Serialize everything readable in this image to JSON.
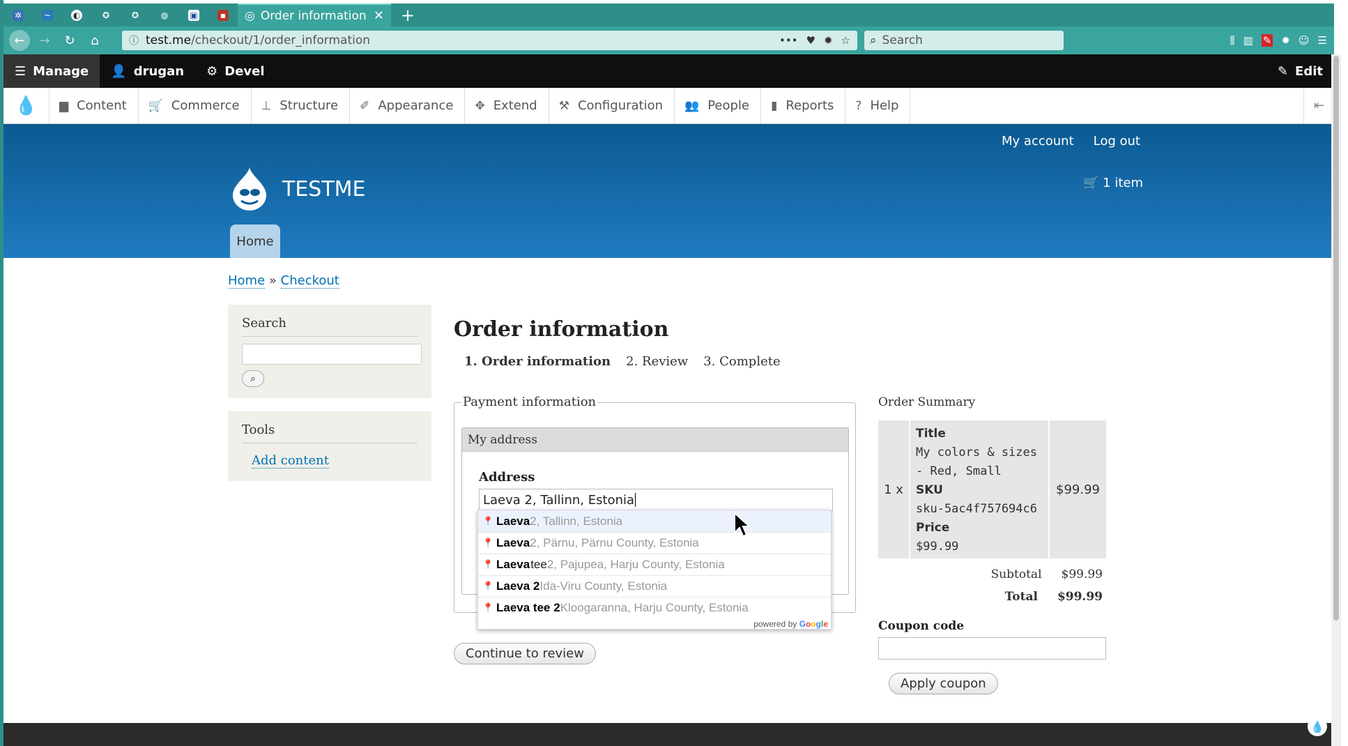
{
  "browser": {
    "active_tab_title": "Order information",
    "url_host": "test.me",
    "url_path": "/checkout/1/order_information",
    "search_placeholder": "Search",
    "new_tab_glyph": "+",
    "close_glyph": "✕"
  },
  "toolbar": {
    "manage": "Manage",
    "user": "drugan",
    "devel": "Devel",
    "edit": "Edit",
    "tray_items": [
      "Content",
      "Commerce",
      "Structure",
      "Appearance",
      "Extend",
      "Configuration",
      "People",
      "Reports",
      "Help"
    ]
  },
  "header": {
    "my_account": "My account",
    "log_out": "Log out",
    "site_name": "TESTME",
    "cart": "1 item",
    "home_tab": "Home"
  },
  "breadcrumb": {
    "home": "Home",
    "separator": "»",
    "checkout": "Checkout"
  },
  "sidebar": {
    "search_title": "Search",
    "tools_title": "Tools",
    "add_content": "Add content"
  },
  "main": {
    "title": "Order information",
    "steps": [
      "1. Order information",
      "2. Review",
      "3. Complete"
    ],
    "payment_legend": "Payment information",
    "address_panel_title": "My address",
    "address_label": "Address",
    "address_value": "Laeva 2, Tallinn, Estonia",
    "continue_button": "Continue to review"
  },
  "autocomplete": {
    "items": [
      {
        "match": "Laeva",
        "rest": "",
        "secondary": " 2, Tallinn, Estonia"
      },
      {
        "match": "Laeva",
        "rest": "",
        "secondary": " 2, Pärnu, Pärnu County, Estonia"
      },
      {
        "match": "Laeva",
        "rest": " tee",
        "secondary": " 2, Pajupea, Harju County, Estonia"
      },
      {
        "match": "Laeva 2",
        "rest": "",
        "secondary": " Ida-Viru County, Estonia"
      },
      {
        "match": "Laeva tee 2",
        "rest": "",
        "secondary": " Kloogaranna, Harju County, Estonia"
      }
    ],
    "powered_by": "powered by"
  },
  "order_summary": {
    "title": "Order Summary",
    "quantity": "1 x",
    "title_label": "Title",
    "product_title": "My colors & sizes - Red, Small",
    "sku_label": "SKU",
    "sku": "sku-5ac4f757694c6",
    "price_label": "Price",
    "unit_price": "$99.99",
    "line_total": "$99.99",
    "subtotal_label": "Subtotal",
    "subtotal": "$99.99",
    "total_label": "Total",
    "total": "$99.99",
    "coupon_label": "Coupon code",
    "apply_button": "Apply coupon"
  },
  "colors": {
    "header_blue": "#0c5a92",
    "link_blue": "#0071b3",
    "toolbar_black": "#0f0f0f",
    "browser_teal": "#2e8f8a"
  }
}
